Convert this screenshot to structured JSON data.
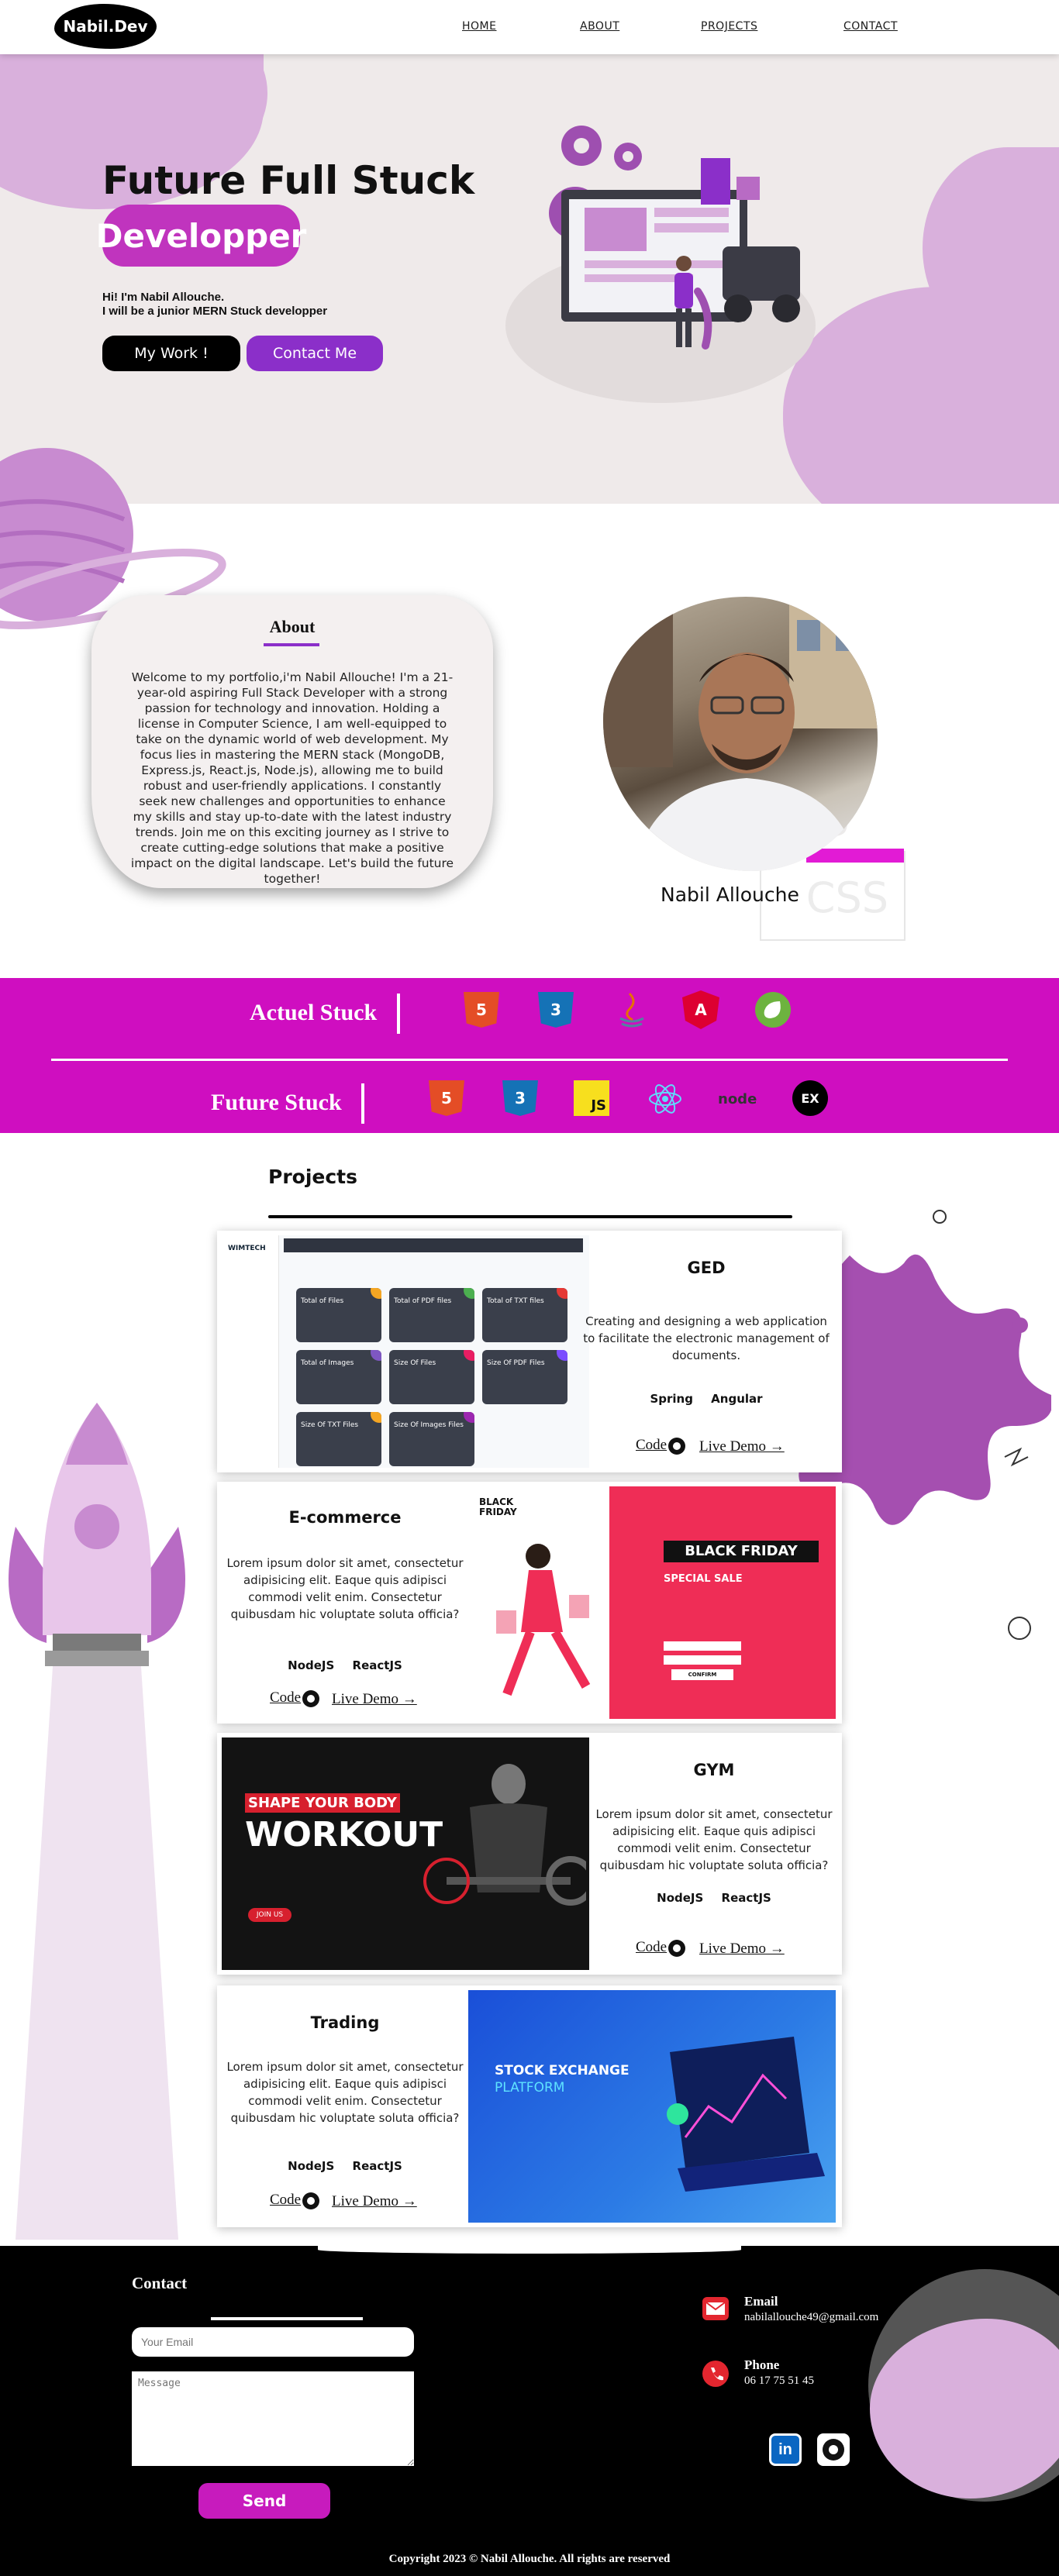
{
  "nav": {
    "logo": "Nabil.Dev",
    "links": [
      "HOME",
      "ABOUT",
      "PROJECTS",
      "CONTACT"
    ]
  },
  "hero": {
    "title_line1": "Future Full Stuck",
    "title_line2": "Developper",
    "intro_line1": "Hi! I'm Nabil Allouche.",
    "intro_line2": "I will be a junior MERN Stuck developper",
    "btn_work": "My Work !",
    "btn_contact": "Contact Me"
  },
  "about": {
    "title": "About",
    "text": "Welcome to my portfolio,i'm Nabil Allouche! I'm a 21-year-old aspiring Full Stack Developer with a strong passion for technology and innovation. Holding a license in Computer Science, I am well-equipped to take on the dynamic world of web development. My focus lies in mastering the MERN stack (MongoDB, Express.js, React.js, Node.js), allowing me to build robust and user-friendly applications. I constantly seek new challenges and opportunities to enhance my skills and stay up-to-date with the latest industry trends. Join me on this exciting journey as I strive to create cutting-edge solutions that make a positive impact on the digital landscape. Let's build the future together!",
    "name": "Nabil Allouche",
    "deco_text": "CSS"
  },
  "stack": {
    "actual_label": "Actuel Stuck",
    "future_label": "Future Stuck",
    "actual_icons": [
      "html5-icon",
      "css3-icon",
      "java-icon",
      "angular-icon",
      "spring-icon"
    ],
    "future_icons": [
      "html5-icon",
      "css3-icon",
      "javascript-icon",
      "react-icon",
      "node-icon",
      "express-icon"
    ],
    "html_glyph": "5",
    "css_glyph": "3",
    "js_glyph": "JS",
    "angular_glyph": "A",
    "node_glyph": "node",
    "express_glyph": "EX"
  },
  "projects": {
    "title": "Projects",
    "code_label": "Code",
    "demo_label": "Live Demo →",
    "items": [
      {
        "title": "GED",
        "desc": "Creating and designing a web application to facilitate the electronic management of documents.",
        "tech": "Spring Angular",
        "screen": {
          "brand": "WIMTECH",
          "tiles": [
            "Total of Files",
            "Total of PDF files",
            "Total of TXT files",
            "Total of Images",
            "Size Of Files",
            "Size Of PDF Files",
            "Size Of TXT Files",
            "Size Of Images Files"
          ]
        }
      },
      {
        "title": "E-commerce",
        "desc": "Lorem ipsum dolor sit amet, consectetur adipisicing elit. Eaque quis adipisci commodi velit enim. Consectetur quibusdam hic voluptate soluta officia?",
        "tech": "NodeJS ReactJS",
        "screen": {
          "badge_line1": "BLACK",
          "badge_line2": "FRIDAY",
          "headline": "BLACK FRIDAY",
          "sub": "SPECIAL SALE",
          "button": "CONFIRM"
        }
      },
      {
        "title": "GYM",
        "desc": "Lorem ipsum dolor sit amet, consectetur adipisicing elit. Eaque quis adipisci commodi velit enim. Consectetur quibusdam hic voluptate soluta officia?",
        "tech": "NodeJS ReactJS",
        "screen": {
          "line1": "SHAPE YOUR BODY",
          "line2": "WORKOUT",
          "button": "JOIN US"
        }
      },
      {
        "title": "Trading",
        "desc": "Lorem ipsum dolor sit amet, consectetur adipisicing elit. Eaque quis adipisci commodi velit enim. Consectetur quibusdam hic voluptate soluta officia?",
        "tech": "NodeJS ReactJS",
        "screen": {
          "line1": "STOCK EXCHANGE",
          "line2": "PLATFORM"
        }
      }
    ]
  },
  "contact": {
    "title": "Contact",
    "email_placeholder": "Your Email",
    "message_placeholder": "Message",
    "send": "Send",
    "email_label": "Email",
    "email_value": "nabilallouche49@gmail.com",
    "phone_label": "Phone",
    "phone_value": "06 17 75 51 45",
    "copyright": "Copyright 2023 © Nabil Allouche. All rights are reserved"
  },
  "colors": {
    "brand_purple": "#c034be",
    "band_magenta": "#cf0ec0",
    "button_violet": "#8b2fc9",
    "blob_lilac": "#d9b0dc"
  }
}
